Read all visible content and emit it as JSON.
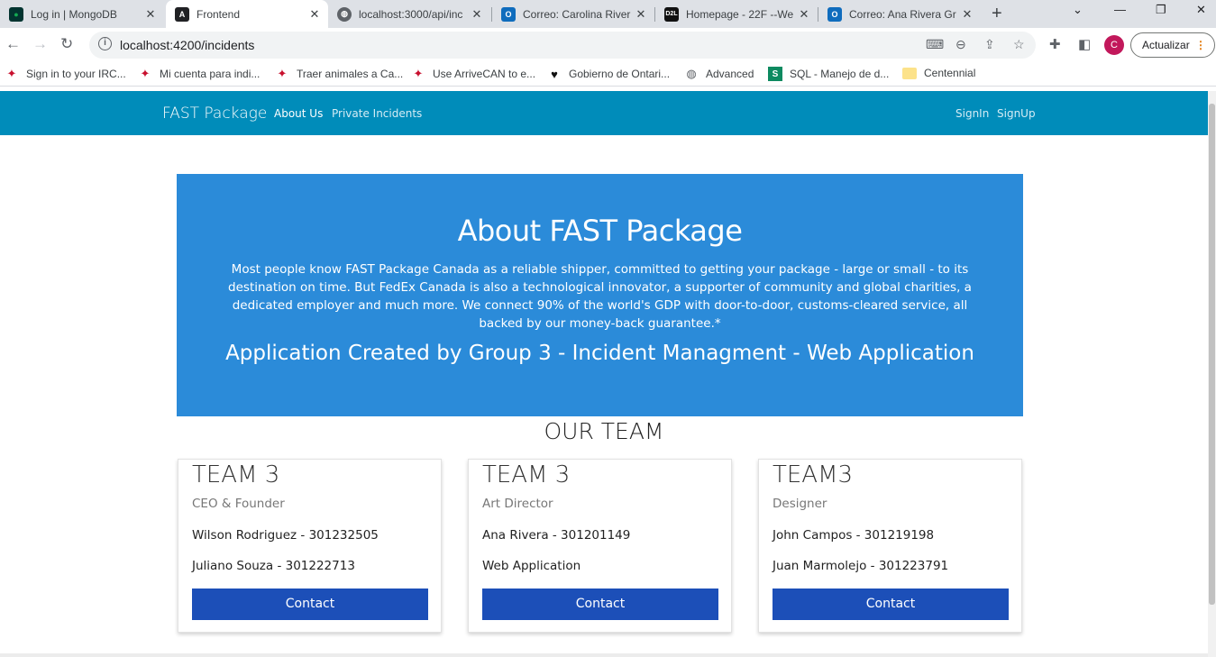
{
  "browser": {
    "tabs": [
      {
        "title": "Log in | MongoDB",
        "favicon": "mongodb-leaf-icon",
        "color": "#13aa52",
        "active": false
      },
      {
        "title": "Frontend",
        "favicon": "angular-icon",
        "color": "#202124",
        "active": true
      },
      {
        "title": "localhost:3000/api/inc",
        "favicon": "globe-icon",
        "color": "#5f6368",
        "active": false
      },
      {
        "title": "Correo: Carolina River",
        "favicon": "outlook-icon",
        "color": "#0f6cbd",
        "active": false
      },
      {
        "title": "Homepage - 22F --We",
        "favicon": "d2l-icon",
        "color": "#111111",
        "active": false
      },
      {
        "title": "Correo: Ana Rivera Gr",
        "favicon": "outlook-icon",
        "color": "#0f6cbd",
        "active": false
      }
    ],
    "url": "localhost:4200/incidents",
    "profile_initial": "C",
    "update_label": "Actualizar",
    "bookmarks": [
      {
        "label": "Sign in to your IRC...",
        "icon": "maple-leaf-icon"
      },
      {
        "label": "Mi cuenta para indi...",
        "icon": "maple-leaf-icon"
      },
      {
        "label": "Traer animales a Ca...",
        "icon": "maple-leaf-icon"
      },
      {
        "label": "Use ArriveCAN to e...",
        "icon": "maple-leaf-icon"
      },
      {
        "label": "Gobierno de Ontari...",
        "icon": "ontario-icon"
      },
      {
        "label": "Advanced",
        "icon": "globe-icon"
      },
      {
        "label": "SQL - Manejo de d...",
        "icon": "sql-icon"
      },
      {
        "label": "Centennial",
        "icon": "folder-icon"
      }
    ]
  },
  "navbar": {
    "brand": "FAST Package",
    "links": [
      "About Us",
      "Private Incidents"
    ],
    "auth": [
      "SignIn",
      "SignUp"
    ]
  },
  "hero": {
    "title": "About FAST Package",
    "body": "Most people know FAST Package Canada as a reliable shipper, committed to getting your package - large or small - to its destination on time. But FedEx Canada is also a technological innovator, a supporter of community and global charities, a dedicated employer and much more. We connect 90% of the world's GDP with door-to-door, customs-cleared service, all backed by our money-back guarantee.*",
    "subtitle": "Application Created by Group 3 - Incident Managment - Web Application"
  },
  "team": {
    "heading": "OUR TEAM",
    "cards": [
      {
        "title": "TEAM 3",
        "role": "CEO & Founder",
        "line1": "Wilson Rodriguez - 301232505",
        "line2": "Juliano Souza - 301222713",
        "button": "Contact"
      },
      {
        "title": "TEAM 3",
        "role": "Art Director",
        "line1": "Ana Rivera - 301201149",
        "line2": "Web Application",
        "button": "Contact"
      },
      {
        "title": "TEAM3",
        "role": "Designer",
        "line1": "John Campos - 301219198",
        "line2": "Juan Marmolejo - 301223791",
        "button": "Contact"
      }
    ]
  },
  "colors": {
    "navbar": "#008cba",
    "hero": "#2b8bd9",
    "button": "#1c4fb8"
  }
}
